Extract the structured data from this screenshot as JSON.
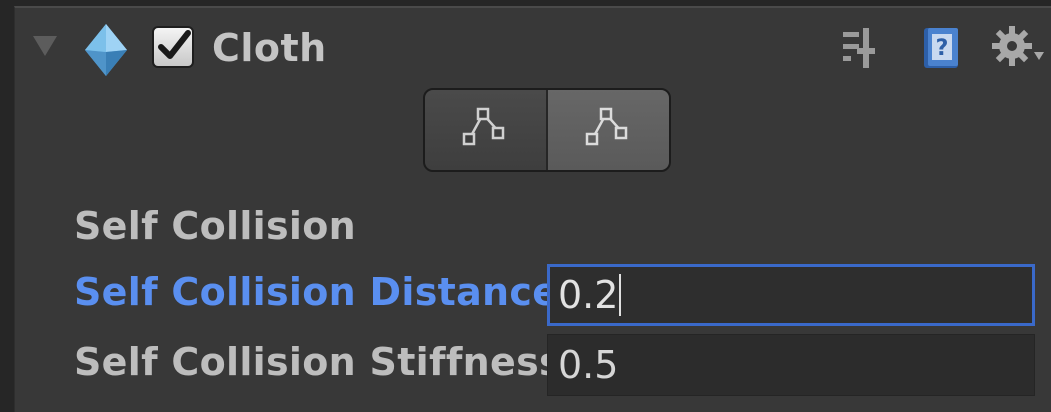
{
  "component": {
    "title": "Cloth",
    "enabled": true,
    "icons": {
      "foldout": "foldout-expanded-icon",
      "component": "cloth-icon",
      "preset": "preset-icon",
      "help": "help-book-icon",
      "settings": "gear-icon"
    }
  },
  "edit_toggle": {
    "buttons": [
      {
        "icon": "edit-constraints-icon",
        "selected": false
      },
      {
        "icon": "edit-constraints-icon",
        "selected": true
      }
    ]
  },
  "properties": {
    "self_collision": {
      "label": "Self Collision"
    },
    "self_collision_distance": {
      "label": "Self Collision Distance",
      "value": "0.2",
      "focused": true
    },
    "self_collision_stiffness": {
      "label": "Self Collision Stiffness",
      "value": "0.5"
    }
  },
  "colors": {
    "panel_bg": "#383838",
    "label_text": "#bdbdbd",
    "focused_label": "#5a8ff0",
    "focus_border": "#3a69c9"
  }
}
